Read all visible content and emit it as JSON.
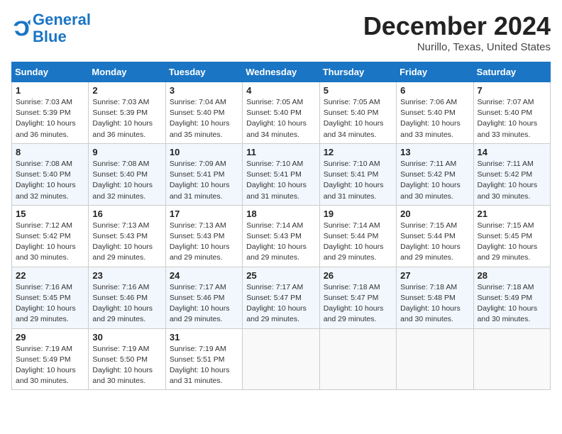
{
  "header": {
    "logo_line1": "General",
    "logo_line2": "Blue",
    "title": "December 2024",
    "subtitle": "Nurillo, Texas, United States"
  },
  "days_of_week": [
    "Sunday",
    "Monday",
    "Tuesday",
    "Wednesday",
    "Thursday",
    "Friday",
    "Saturday"
  ],
  "weeks": [
    [
      {
        "day": "1",
        "sunrise": "7:03 AM",
        "sunset": "5:39 PM",
        "daylight": "10 hours and 36 minutes."
      },
      {
        "day": "2",
        "sunrise": "7:03 AM",
        "sunset": "5:39 PM",
        "daylight": "10 hours and 36 minutes."
      },
      {
        "day": "3",
        "sunrise": "7:04 AM",
        "sunset": "5:40 PM",
        "daylight": "10 hours and 35 minutes."
      },
      {
        "day": "4",
        "sunrise": "7:05 AM",
        "sunset": "5:40 PM",
        "daylight": "10 hours and 34 minutes."
      },
      {
        "day": "5",
        "sunrise": "7:05 AM",
        "sunset": "5:40 PM",
        "daylight": "10 hours and 34 minutes."
      },
      {
        "day": "6",
        "sunrise": "7:06 AM",
        "sunset": "5:40 PM",
        "daylight": "10 hours and 33 minutes."
      },
      {
        "day": "7",
        "sunrise": "7:07 AM",
        "sunset": "5:40 PM",
        "daylight": "10 hours and 33 minutes."
      }
    ],
    [
      {
        "day": "8",
        "sunrise": "7:08 AM",
        "sunset": "5:40 PM",
        "daylight": "10 hours and 32 minutes."
      },
      {
        "day": "9",
        "sunrise": "7:08 AM",
        "sunset": "5:40 PM",
        "daylight": "10 hours and 32 minutes."
      },
      {
        "day": "10",
        "sunrise": "7:09 AM",
        "sunset": "5:41 PM",
        "daylight": "10 hours and 31 minutes."
      },
      {
        "day": "11",
        "sunrise": "7:10 AM",
        "sunset": "5:41 PM",
        "daylight": "10 hours and 31 minutes."
      },
      {
        "day": "12",
        "sunrise": "7:10 AM",
        "sunset": "5:41 PM",
        "daylight": "10 hours and 31 minutes."
      },
      {
        "day": "13",
        "sunrise": "7:11 AM",
        "sunset": "5:42 PM",
        "daylight": "10 hours and 30 minutes."
      },
      {
        "day": "14",
        "sunrise": "7:11 AM",
        "sunset": "5:42 PM",
        "daylight": "10 hours and 30 minutes."
      }
    ],
    [
      {
        "day": "15",
        "sunrise": "7:12 AM",
        "sunset": "5:42 PM",
        "daylight": "10 hours and 30 minutes."
      },
      {
        "day": "16",
        "sunrise": "7:13 AM",
        "sunset": "5:43 PM",
        "daylight": "10 hours and 29 minutes."
      },
      {
        "day": "17",
        "sunrise": "7:13 AM",
        "sunset": "5:43 PM",
        "daylight": "10 hours and 29 minutes."
      },
      {
        "day": "18",
        "sunrise": "7:14 AM",
        "sunset": "5:43 PM",
        "daylight": "10 hours and 29 minutes."
      },
      {
        "day": "19",
        "sunrise": "7:14 AM",
        "sunset": "5:44 PM",
        "daylight": "10 hours and 29 minutes."
      },
      {
        "day": "20",
        "sunrise": "7:15 AM",
        "sunset": "5:44 PM",
        "daylight": "10 hours and 29 minutes."
      },
      {
        "day": "21",
        "sunrise": "7:15 AM",
        "sunset": "5:45 PM",
        "daylight": "10 hours and 29 minutes."
      }
    ],
    [
      {
        "day": "22",
        "sunrise": "7:16 AM",
        "sunset": "5:45 PM",
        "daylight": "10 hours and 29 minutes."
      },
      {
        "day": "23",
        "sunrise": "7:16 AM",
        "sunset": "5:46 PM",
        "daylight": "10 hours and 29 minutes."
      },
      {
        "day": "24",
        "sunrise": "7:17 AM",
        "sunset": "5:46 PM",
        "daylight": "10 hours and 29 minutes."
      },
      {
        "day": "25",
        "sunrise": "7:17 AM",
        "sunset": "5:47 PM",
        "daylight": "10 hours and 29 minutes."
      },
      {
        "day": "26",
        "sunrise": "7:18 AM",
        "sunset": "5:47 PM",
        "daylight": "10 hours and 29 minutes."
      },
      {
        "day": "27",
        "sunrise": "7:18 AM",
        "sunset": "5:48 PM",
        "daylight": "10 hours and 30 minutes."
      },
      {
        "day": "28",
        "sunrise": "7:18 AM",
        "sunset": "5:49 PM",
        "daylight": "10 hours and 30 minutes."
      }
    ],
    [
      {
        "day": "29",
        "sunrise": "7:19 AM",
        "sunset": "5:49 PM",
        "daylight": "10 hours and 30 minutes."
      },
      {
        "day": "30",
        "sunrise": "7:19 AM",
        "sunset": "5:50 PM",
        "daylight": "10 hours and 30 minutes."
      },
      {
        "day": "31",
        "sunrise": "7:19 AM",
        "sunset": "5:51 PM",
        "daylight": "10 hours and 31 minutes."
      },
      null,
      null,
      null,
      null
    ]
  ]
}
